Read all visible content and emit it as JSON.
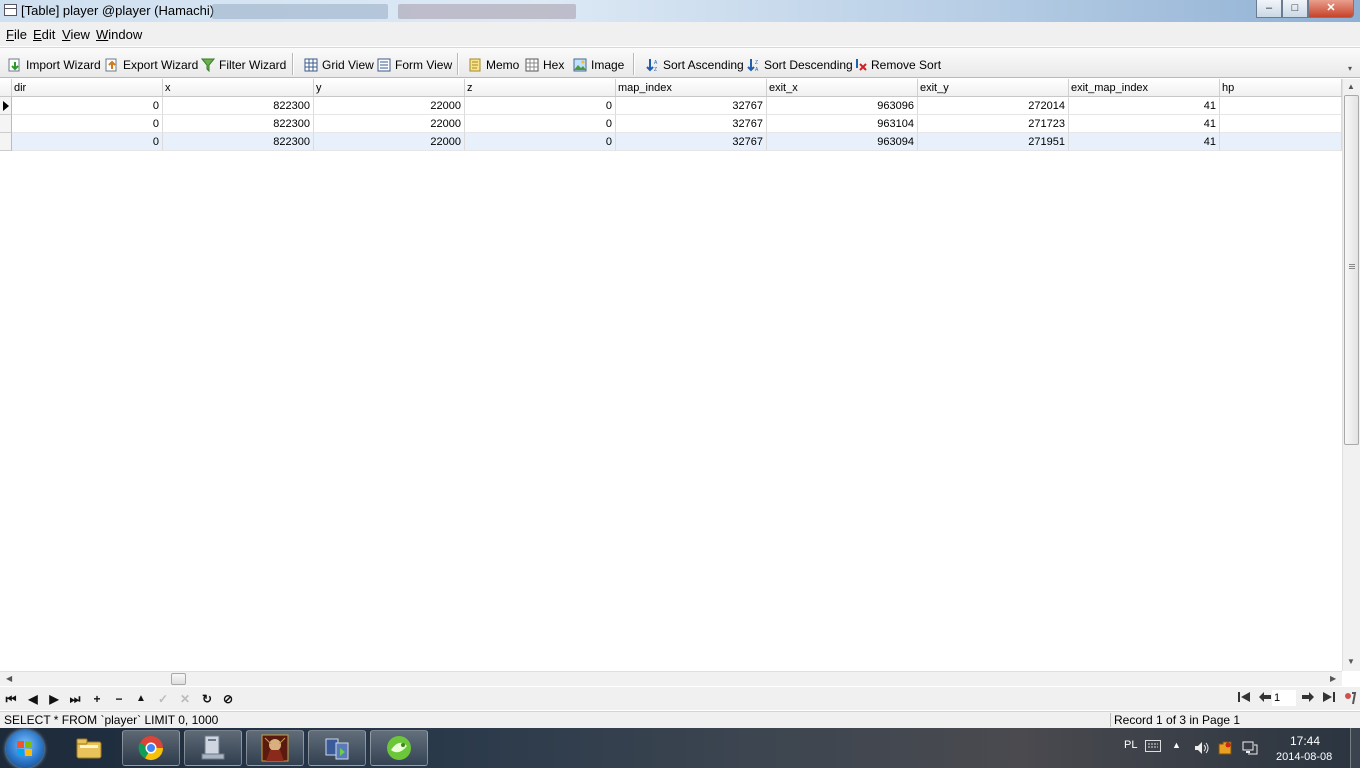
{
  "window": {
    "title": "[Table] player @player (Hamachi)",
    "controls": {
      "minimize": "–",
      "maximize": "□",
      "close": "✕"
    }
  },
  "menu": [
    {
      "label": "File",
      "key": "F",
      "rest": "ile"
    },
    {
      "label": "Edit",
      "key": "E",
      "rest": "dit"
    },
    {
      "label": "View",
      "key": "V",
      "rest": "iew"
    },
    {
      "label": "Window",
      "key": "W",
      "rest": "indow"
    }
  ],
  "toolbar": {
    "import_wizard": "Import Wizard",
    "export_wizard": "Export Wizard",
    "filter_wizard": "Filter Wizard",
    "grid_view": "Grid View",
    "form_view": "Form View",
    "memo": "Memo",
    "hex": "Hex",
    "image": "Image",
    "sort_ascending": "Sort Ascending",
    "sort_descending": "Sort Descending",
    "remove_sort": "Remove Sort"
  },
  "grid": {
    "columns": [
      "dir",
      "x",
      "y",
      "z",
      "map_index",
      "exit_x",
      "exit_y",
      "exit_map_index",
      "hp"
    ],
    "rows": [
      [
        "0",
        "822300",
        "22000",
        "0",
        "32767",
        "963096",
        "272014",
        "41",
        ""
      ],
      [
        "0",
        "822300",
        "22000",
        "0",
        "32767",
        "963104",
        "271723",
        "41",
        ""
      ],
      [
        "0",
        "822300",
        "22000",
        "0",
        "32767",
        "963094",
        "271951",
        "41",
        ""
      ]
    ],
    "current_row": 0
  },
  "navigator": {
    "first": "⏮",
    "prev": "◀",
    "next": "▶",
    "last": "⏭",
    "add": "+",
    "delete": "−",
    "up": "▲",
    "apply": "✓",
    "cancel": "✕",
    "refresh": "↻",
    "stop": "⊘",
    "page_value": "1"
  },
  "status": {
    "sql": "SELECT * FROM `player` LIMIT 0, 1000",
    "record": "Record 1 of 3 in Page 1"
  },
  "taskbar": {
    "language": "PL",
    "time": "17:44",
    "date": "2014-08-08"
  }
}
